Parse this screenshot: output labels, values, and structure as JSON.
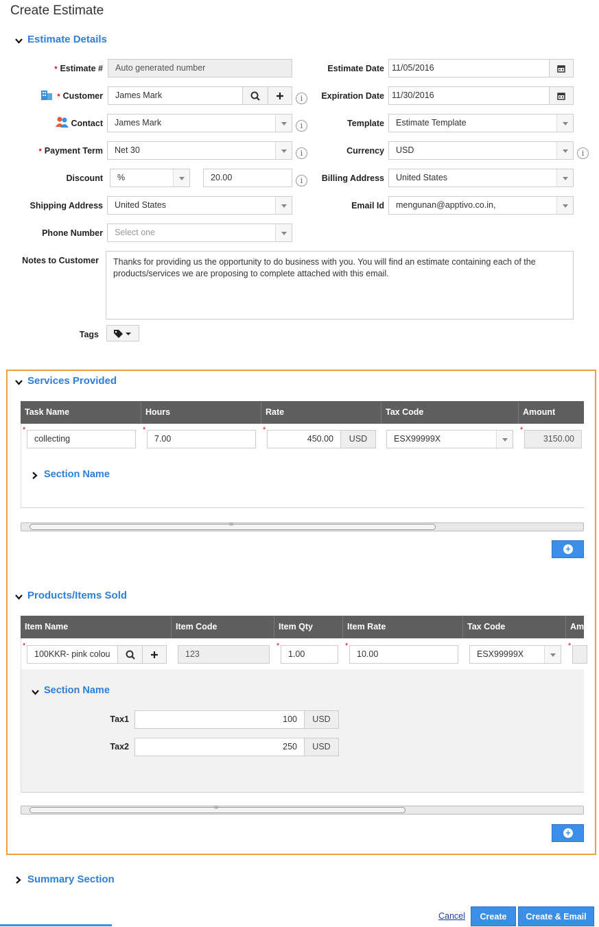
{
  "page": {
    "title": "Create Estimate"
  },
  "estimate_details": {
    "heading": "Estimate Details",
    "estimate_no": {
      "label": "Estimate #",
      "value": "Auto generated number"
    },
    "customer": {
      "label": "Customer",
      "value": "James Mark"
    },
    "contact": {
      "label": "Contact",
      "value": "James Mark"
    },
    "payment_term": {
      "label": "Payment Term",
      "value": "Net 30"
    },
    "discount": {
      "label": "Discount",
      "type": "%",
      "value": "20.00"
    },
    "shipping_address": {
      "label": "Shipping Address",
      "value": "United States"
    },
    "phone_number": {
      "label": "Phone Number",
      "placeholder": "Select one"
    },
    "notes": {
      "label": "Notes to Customer",
      "value": "Thanks for providing us the opportunity to do business with you. You will find an estimate containing each of the products/services we are proposing to complete attached with this email."
    },
    "tags": {
      "label": "Tags"
    },
    "estimate_date": {
      "label": "Estimate Date",
      "value": "11/05/2016"
    },
    "expiration_date": {
      "label": "Expiration Date",
      "value": "11/30/2016"
    },
    "template": {
      "label": "Template",
      "value": "Estimate Template"
    },
    "currency": {
      "label": "Currency",
      "value": "USD"
    },
    "billing_address": {
      "label": "Billing Address",
      "value": "United States"
    },
    "email_id": {
      "label": "Email Id",
      "value": "mengunan@apptivo.co.in,"
    },
    "info_glyph": "i"
  },
  "services": {
    "heading": "Services Provided",
    "columns": [
      "Task Name",
      "Hours",
      "Rate",
      "Tax Code",
      "Amount"
    ],
    "row": {
      "task": "collecting",
      "hours": "7.00",
      "rate": "450.00",
      "rate_unit": "USD",
      "tax_code": "ESX99999X",
      "amount": "3150.00"
    },
    "section_name": "Section Name",
    "scroll_grip": "III"
  },
  "products": {
    "heading": "Products/Items Sold",
    "columns": [
      "Item Name",
      "Item Code",
      "Item Qty",
      "Item Rate",
      "Tax Code",
      "Am"
    ],
    "row": {
      "item_name": "100KKR- pink colou",
      "item_code": "123",
      "qty": "1.00",
      "rate": "10.00",
      "tax_code": "ESX99999X"
    },
    "section_name": "Section Name",
    "tax1": {
      "label": "Tax1",
      "value": "100",
      "unit": "USD"
    },
    "tax2": {
      "label": "Tax2",
      "value": "250",
      "unit": "USD"
    },
    "scroll_grip": "III"
  },
  "summary": {
    "heading": "Summary Section"
  },
  "footer": {
    "cancel": "Cancel",
    "create": "Create",
    "create_email": "Create & Email"
  },
  "colors": {
    "accent": "#2f7ed8",
    "button": "#3b8fe8",
    "highlight": "#f0a040",
    "header": "#5e5e5e"
  }
}
